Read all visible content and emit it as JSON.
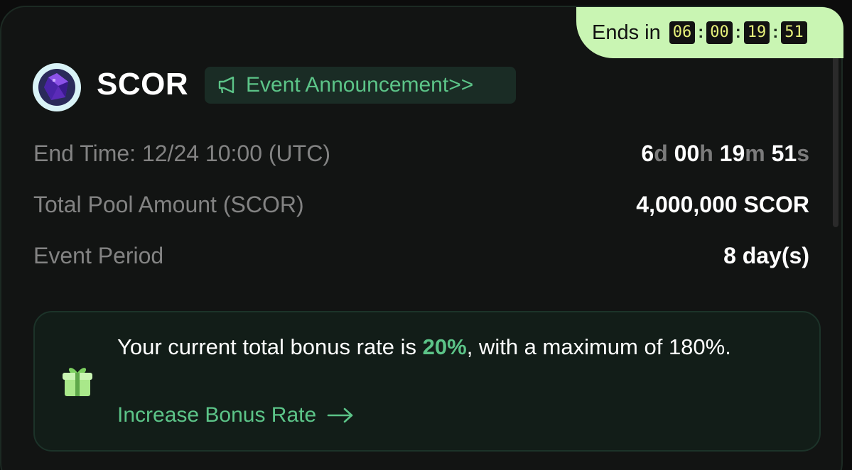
{
  "countdown": {
    "label": "Ends in",
    "days": "06",
    "hours": "00",
    "minutes": "19",
    "seconds": "51",
    "accent": "#c9f5b3"
  },
  "token": {
    "name": "SCOR",
    "logo_icon": "purple-gem-icon"
  },
  "announcement": {
    "label": "Event Announcement>>",
    "icon": "megaphone-icon"
  },
  "details": {
    "end_time": {
      "label": "End Time: 12/24 10:00 (UTC)",
      "days": "6",
      "d_unit": "d",
      "hours": "00",
      "h_unit": "h",
      "minutes": "19",
      "m_unit": "m",
      "seconds": "51",
      "s_unit": "s"
    },
    "pool": {
      "label": "Total Pool Amount (SCOR)",
      "value": "4,000,000 SCOR"
    },
    "period": {
      "label": "Event Period",
      "value": "8 day(s)"
    }
  },
  "bonus": {
    "text_prefix": "Your current total bonus rate is ",
    "rate": "20%",
    "text_suffix": ", with a maximum of 180%.",
    "link_label": "Increase Bonus Rate",
    "icon": "gift-icon",
    "accent": "#5cc488"
  }
}
